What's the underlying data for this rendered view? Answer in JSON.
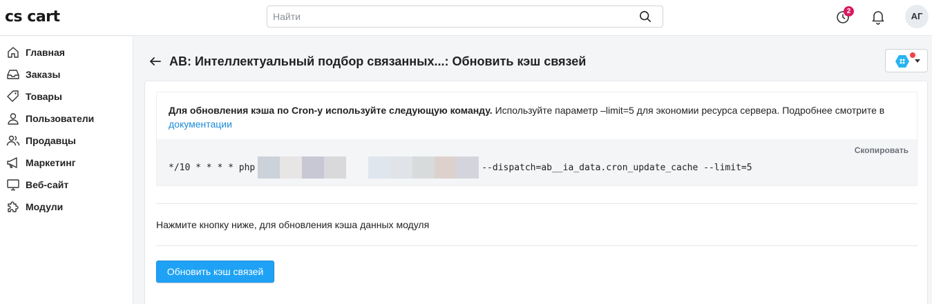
{
  "header": {
    "logo": "cs cart",
    "search_placeholder": "Найти",
    "notifications_count": "2",
    "avatar_initials": "АГ"
  },
  "sidebar": {
    "items": [
      {
        "label": "Главная",
        "icon": "home-icon"
      },
      {
        "label": "Заказы",
        "icon": "inbox-icon"
      },
      {
        "label": "Товары",
        "icon": "tag-icon"
      },
      {
        "label": "Пользователи",
        "icon": "user-icon"
      },
      {
        "label": "Продавцы",
        "icon": "users-icon"
      },
      {
        "label": "Маркетинг",
        "icon": "megaphone-icon"
      },
      {
        "label": "Веб-сайт",
        "icon": "monitor-icon"
      },
      {
        "label": "Модули",
        "icon": "puzzle-icon"
      }
    ]
  },
  "main": {
    "title": "AB: Интеллектуальный подбор связанных...: Обновить кэш связей",
    "notice": {
      "bold_text": "Для обновления кэша по Cron-у используйте следующую команду.",
      "text": " Используйте параметр –limit=5 для экономии ресурса сервера. Подробнее смотрите в ",
      "link_text": "документации",
      "copy_label": "Скопировать",
      "code_prefix": "*/10 * * * * php",
      "code_suffix": "--dispatch=ab__ia_data.cron_update_cache --limit=5"
    },
    "hint": "Нажмите кнопку ниже, для обновления кэша данных модуля",
    "button_label": "Обновить кэш связей"
  },
  "colors": {
    "accent": "#1fa2f5",
    "badge": "#d9195e",
    "link": "#1a8ad8"
  }
}
